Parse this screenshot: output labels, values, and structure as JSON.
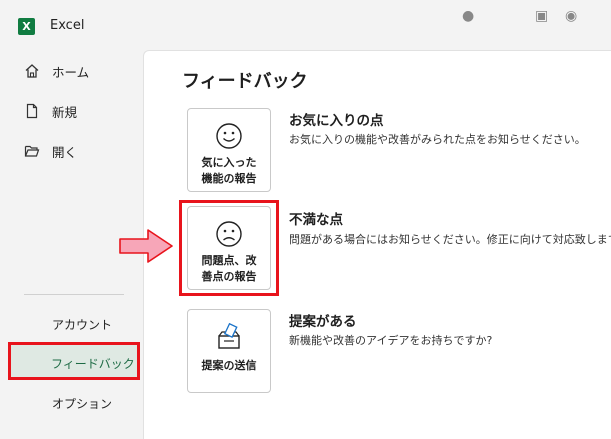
{
  "window": {
    "app_title": "Excel",
    "app_logo_letter": "X",
    "accent": "#107c41"
  },
  "sidebar": {
    "top_items": [
      {
        "label": "ホーム",
        "icon": "home-icon"
      },
      {
        "label": "新規",
        "icon": "new-document-icon"
      },
      {
        "label": "開く",
        "icon": "folder-open-icon"
      }
    ],
    "bottom_items": [
      {
        "label": "アカウント"
      },
      {
        "label": "フィードバック",
        "selected": true
      },
      {
        "label": "オプション"
      }
    ]
  },
  "main": {
    "title": "フィードバック",
    "options": [
      {
        "tile_label": "気に入った\n機能の報告",
        "icon": "smiley-face-icon",
        "heading": "お気に入りの点",
        "description": "お気に入りの機能や改善がみられた点をお知らせください。"
      },
      {
        "tile_label": "問題点、改\n善点の報告",
        "icon": "frown-face-icon",
        "heading": "不満な点",
        "description": "問題がある場合にはお知らせください。修正に向けて対応致します。"
      },
      {
        "tile_label": "提案の送信",
        "icon": "suggestion-box-icon",
        "heading": "提案がある",
        "description": "新機能や改善のアイデアをお持ちですか?"
      }
    ]
  },
  "annotations": {
    "highlight_color": "#e8141c",
    "arrow_color": "#f7a6b8"
  }
}
